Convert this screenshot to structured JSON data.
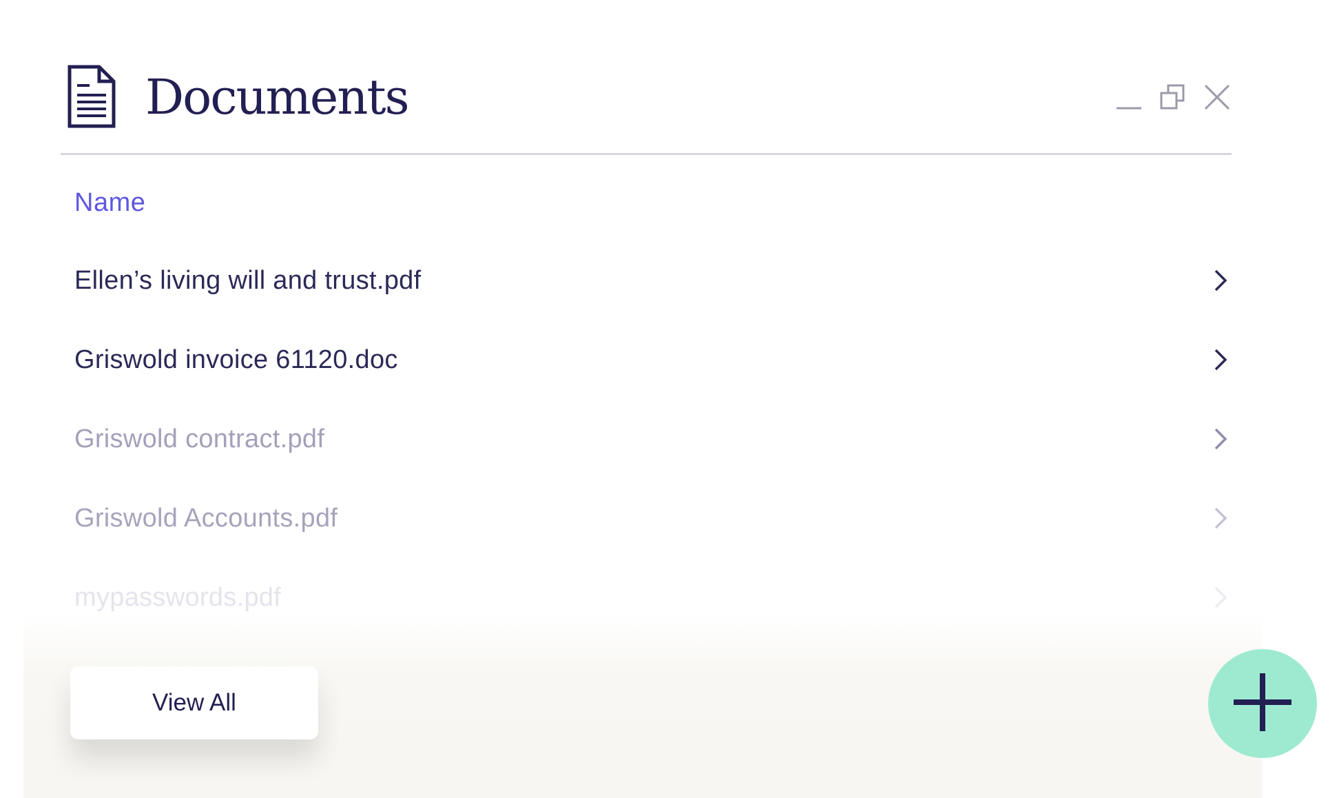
{
  "header": {
    "title": "Documents",
    "icon": "document-icon",
    "controls": {
      "minimize_icon": "minimize-icon",
      "restore_icon": "restore-icon",
      "close_icon": "close-icon"
    }
  },
  "table": {
    "column_header": "Name",
    "rows": [
      {
        "label": "Ellen’s living will and trust.pdf",
        "icon": "chevron-right-icon"
      },
      {
        "label": "Griswold invoice 61120.doc",
        "icon": "chevron-right-icon"
      },
      {
        "label": "Griswold contract.pdf",
        "icon": "chevron-right-icon"
      },
      {
        "label": "Griswold Accounts.pdf",
        "icon": "chevron-right-icon"
      },
      {
        "label": "mypasswords.pdf",
        "icon": "chevron-right-icon"
      }
    ]
  },
  "footer": {
    "view_all_label": "View All",
    "add_icon": "plus-icon"
  },
  "colors": {
    "title": "#221f52",
    "accent": "#5f57df",
    "fab": "#9eead0",
    "divider": "#d6d6e0"
  }
}
